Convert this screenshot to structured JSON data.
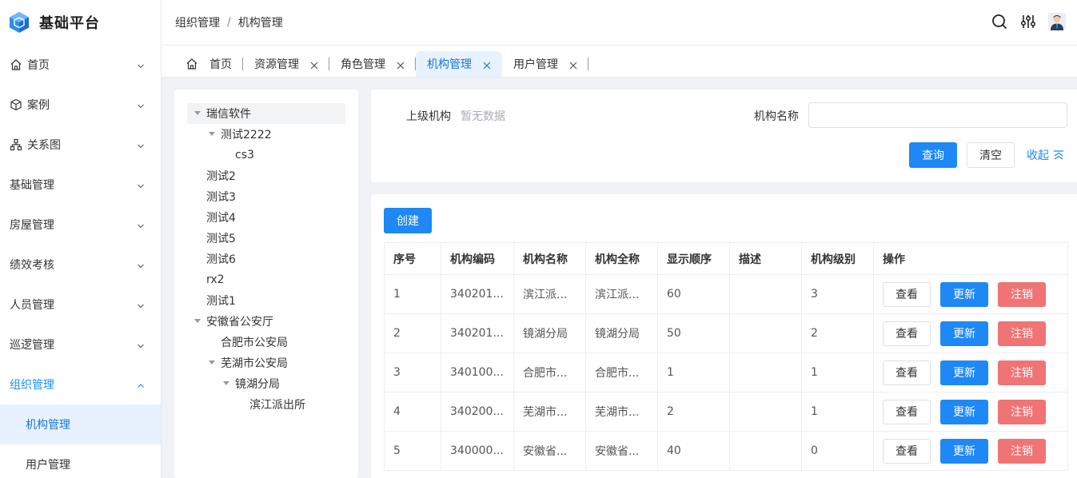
{
  "app": {
    "title": "基础平台"
  },
  "sidebar": {
    "items": [
      {
        "label": "首页",
        "icon": "home-icon",
        "open": false
      },
      {
        "label": "案例",
        "icon": "box-icon",
        "open": false
      },
      {
        "label": "关系图",
        "icon": "sitemap-icon",
        "open": false
      },
      {
        "label": "基础管理",
        "icon": "",
        "open": false
      },
      {
        "label": "房屋管理",
        "icon": "",
        "open": false
      },
      {
        "label": "绩效考核",
        "icon": "",
        "open": false
      },
      {
        "label": "人员管理",
        "icon": "",
        "open": false
      },
      {
        "label": "巡逻管理",
        "icon": "",
        "open": false
      },
      {
        "label": "组织管理",
        "icon": "",
        "open": true
      }
    ],
    "subitems": [
      {
        "label": "机构管理",
        "active": true
      },
      {
        "label": "用户管理",
        "active": false
      }
    ]
  },
  "header": {
    "breadcrumb": [
      "组织管理",
      "机构管理"
    ],
    "breadcrumb_sep": "/"
  },
  "tabs": [
    {
      "label": "首页",
      "icon": "home-icon",
      "closable": false,
      "active": false
    },
    {
      "label": "资源管理",
      "closable": true,
      "active": false
    },
    {
      "label": "角色管理",
      "closable": true,
      "active": false
    },
    {
      "label": "机构管理",
      "closable": true,
      "active": true
    },
    {
      "label": "用户管理",
      "closable": true,
      "active": false
    }
  ],
  "tree": [
    {
      "label": "瑞信软件",
      "level": 0,
      "expanded": true,
      "hasChildren": true,
      "selected": true
    },
    {
      "label": "测试2222",
      "level": 1,
      "expanded": true,
      "hasChildren": true
    },
    {
      "label": "cs3",
      "level": 2,
      "hasChildren": false
    },
    {
      "label": "测试2",
      "level": 0,
      "hasChildren": false
    },
    {
      "label": "测试3",
      "level": 0,
      "hasChildren": false
    },
    {
      "label": "测试4",
      "level": 0,
      "hasChildren": false
    },
    {
      "label": "测试5",
      "level": 0,
      "hasChildren": false
    },
    {
      "label": "测试6",
      "level": 0,
      "hasChildren": false
    },
    {
      "label": "rx2",
      "level": 0,
      "hasChildren": false
    },
    {
      "label": "测试1",
      "level": 0,
      "hasChildren": false
    },
    {
      "label": "安徽省公安厅",
      "level": 0,
      "expanded": true,
      "hasChildren": true
    },
    {
      "label": "合肥市公安局",
      "level": 1,
      "hasChildren": false
    },
    {
      "label": "芜湖市公安局",
      "level": 1,
      "expanded": true,
      "hasChildren": true
    },
    {
      "label": "镜湖分局",
      "level": 2,
      "expanded": true,
      "hasChildren": true
    },
    {
      "label": "滨江派出所",
      "level": 3,
      "hasChildren": false
    }
  ],
  "search": {
    "parent_label": "上级机构",
    "parent_value": "暂无数据",
    "name_label": "机构名称",
    "name_value": "",
    "query_btn": "查询",
    "clear_btn": "清空",
    "collapse_link": "收起"
  },
  "table": {
    "create_btn": "创建",
    "columns": [
      "序号",
      "机构编码",
      "机构名称",
      "机构全称",
      "显示顺序",
      "描述",
      "机构级别",
      "操作"
    ],
    "rows": [
      [
        "1",
        "340201...",
        "滨江派...",
        "滨江派...",
        "60",
        "",
        "3"
      ],
      [
        "2",
        "340201...",
        "镜湖分局",
        "镜湖分局",
        "50",
        "",
        "2"
      ],
      [
        "3",
        "340100...",
        "合肥市...",
        "合肥市...",
        "1",
        "",
        "1"
      ],
      [
        "4",
        "340200...",
        "芜湖市...",
        "芜湖市...",
        "2",
        "",
        "1"
      ],
      [
        "5",
        "340000...",
        "安徽省...",
        "安徽省...",
        "40",
        "",
        "0"
      ]
    ],
    "actions": {
      "view": "查看",
      "update": "更新",
      "cancel": "注销"
    }
  },
  "colors": {
    "accent": "#1e88f5",
    "danger": "#f07474",
    "active_bg": "#e8f2ff"
  }
}
